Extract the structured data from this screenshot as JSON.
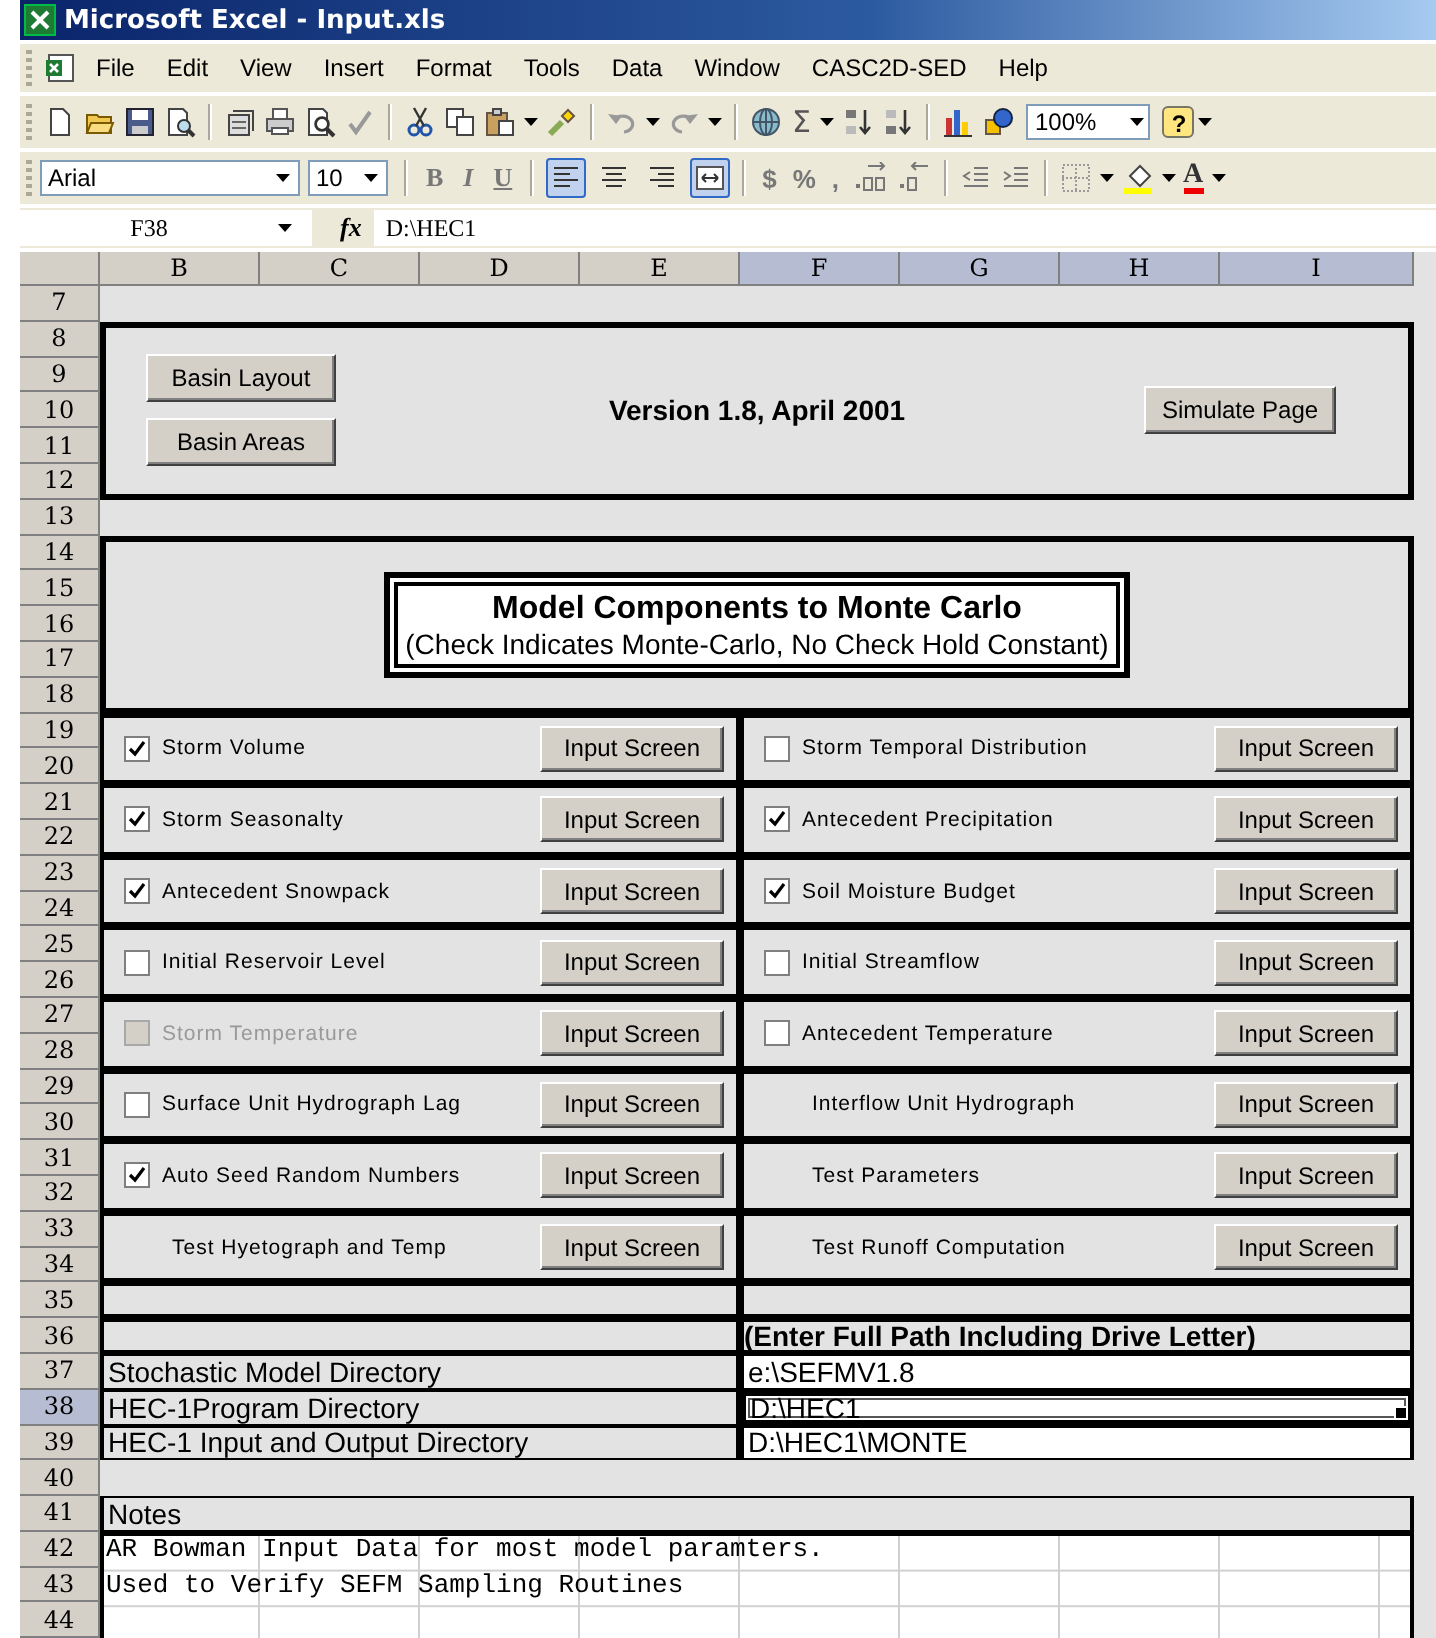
{
  "window": {
    "title": "Microsoft Excel - Input.xls"
  },
  "menu": [
    "File",
    "Edit",
    "View",
    "Insert",
    "Format",
    "Tools",
    "Data",
    "Window",
    "CASC2D-SED",
    "Help"
  ],
  "standard_toolbar": {
    "autosum": "Σ",
    "zoom": "100%",
    "help": "?"
  },
  "formatting_toolbar": {
    "font": "Arial",
    "size": "10",
    "styles": [
      "B",
      "I",
      "U"
    ],
    "alignment": [
      {
        "kind": "left",
        "selected": true
      },
      {
        "kind": "center",
        "selected": false
      },
      {
        "kind": "right",
        "selected": false
      },
      {
        "kind": "merge",
        "selected": true
      }
    ],
    "number_formats": [
      "$",
      "%",
      ","
    ],
    "font_color": "A"
  },
  "formula_bar": {
    "name_box": "F38",
    "fx": "fx",
    "value": "D:\\HEC1"
  },
  "columns": [
    {
      "label": "B",
      "selected": false
    },
    {
      "label": "C",
      "selected": false
    },
    {
      "label": "D",
      "selected": false
    },
    {
      "label": "E",
      "selected": false
    },
    {
      "label": "F",
      "selected": true
    },
    {
      "label": "G",
      "selected": true
    },
    {
      "label": "H",
      "selected": true
    },
    {
      "label": "I",
      "selected": true
    }
  ],
  "rows": [
    {
      "label": "7",
      "selected": false
    },
    {
      "label": "8",
      "selected": false
    },
    {
      "label": "9",
      "selected": false
    },
    {
      "label": "10",
      "selected": false
    },
    {
      "label": "11",
      "selected": false
    },
    {
      "label": "12",
      "selected": false
    },
    {
      "label": "13",
      "selected": false
    },
    {
      "label": "14",
      "selected": false
    },
    {
      "label": "15",
      "selected": false
    },
    {
      "label": "16",
      "selected": false
    },
    {
      "label": "17",
      "selected": false
    },
    {
      "label": "18",
      "selected": false
    },
    {
      "label": "19",
      "selected": false
    },
    {
      "label": "20",
      "selected": false
    },
    {
      "label": "21",
      "selected": false
    },
    {
      "label": "22",
      "selected": false
    },
    {
      "label": "23",
      "selected": false
    },
    {
      "label": "24",
      "selected": false
    },
    {
      "label": "25",
      "selected": false
    },
    {
      "label": "26",
      "selected": false
    },
    {
      "label": "27",
      "selected": false
    },
    {
      "label": "28",
      "selected": false
    },
    {
      "label": "29",
      "selected": false
    },
    {
      "label": "30",
      "selected": false
    },
    {
      "label": "31",
      "selected": false
    },
    {
      "label": "32",
      "selected": false
    },
    {
      "label": "33",
      "selected": false
    },
    {
      "label": "34",
      "selected": false
    },
    {
      "label": "35",
      "selected": false
    },
    {
      "label": "36",
      "selected": false
    },
    {
      "label": "37",
      "selected": false
    },
    {
      "label": "38",
      "selected": true
    },
    {
      "label": "39",
      "selected": false
    },
    {
      "label": "40",
      "selected": false
    },
    {
      "label": "41",
      "selected": false
    },
    {
      "label": "42",
      "selected": false
    },
    {
      "label": "43",
      "selected": false
    },
    {
      "label": "44",
      "selected": false
    }
  ],
  "header": {
    "buttons": [
      "Basin Layout",
      "Basin Areas"
    ],
    "version": "Version 1.8, April 2001",
    "simulate_button": "Simulate Page"
  },
  "title_box": {
    "title": "Model Components to Monte Carlo",
    "subtitle": "(Check Indicates Monte-Carlo, No Check Hold Constant)"
  },
  "components": [
    {
      "kind": "checkbox",
      "label": "Storm Volume",
      "checked": true,
      "disabled": false,
      "button": "Input Screen"
    },
    {
      "kind": "checkbox",
      "label": "Storm Temporal Distribution",
      "checked": false,
      "disabled": false,
      "button": "Input Screen"
    },
    {
      "kind": "checkbox",
      "label": "Storm Seasonalty",
      "checked": true,
      "disabled": false,
      "button": "Input Screen"
    },
    {
      "kind": "checkbox",
      "label": "Antecedent Precipitation",
      "checked": true,
      "disabled": false,
      "button": "Input Screen"
    },
    {
      "kind": "checkbox",
      "label": "Antecedent Snowpack",
      "checked": true,
      "disabled": false,
      "button": "Input Screen"
    },
    {
      "kind": "checkbox",
      "label": "Soil Moisture Budget",
      "checked": true,
      "disabled": false,
      "button": "Input Screen"
    },
    {
      "kind": "checkbox",
      "label": "Initial Reservoir Level",
      "checked": false,
      "disabled": false,
      "button": "Input Screen"
    },
    {
      "kind": "checkbox",
      "label": "Initial Streamflow",
      "checked": false,
      "disabled": false,
      "button": "Input Screen"
    },
    {
      "kind": "checkbox",
      "label": "Storm Temperature",
      "checked": false,
      "disabled": true,
      "button": "Input Screen"
    },
    {
      "kind": "checkbox",
      "label": "Antecedent Temperature",
      "checked": false,
      "disabled": false,
      "button": "Input Screen"
    },
    {
      "kind": "checkbox",
      "label": "Surface Unit Hydrograph Lag",
      "checked": false,
      "disabled": false,
      "button": "Input Screen"
    },
    {
      "kind": "plain",
      "label": "Interflow Unit Hydrograph",
      "button": "Input Screen"
    },
    {
      "kind": "checkbox",
      "label": "Auto Seed Random Numbers",
      "checked": true,
      "disabled": false,
      "button": "Input Screen"
    },
    {
      "kind": "plain",
      "label": "Test Parameters",
      "button": "Input Screen"
    },
    {
      "kind": "plain",
      "label": "Test Hyetograph and Temp",
      "button": "Input Screen"
    },
    {
      "kind": "plain",
      "label": "Test Runoff Computation",
      "button": "Input Screen"
    }
  ],
  "paths": {
    "heading": "(Enter Full Path Including Drive Letter)",
    "directories": [
      {
        "label": "Stochastic Model Directory",
        "value": "e:\\SEFMV1.8",
        "selected": false
      },
      {
        "label": "HEC-1Program Directory",
        "value": "D:\\HEC1",
        "selected": true
      },
      {
        "label": "HEC-1 Input and Output Directory",
        "value": "D:\\HEC1\\MONTE",
        "selected": false
      }
    ]
  },
  "notes": {
    "heading": "Notes",
    "lines": [
      "AR Bowman Input Data for most model paramters.",
      "Used to Verify SEFM Sampling Routines"
    ]
  }
}
